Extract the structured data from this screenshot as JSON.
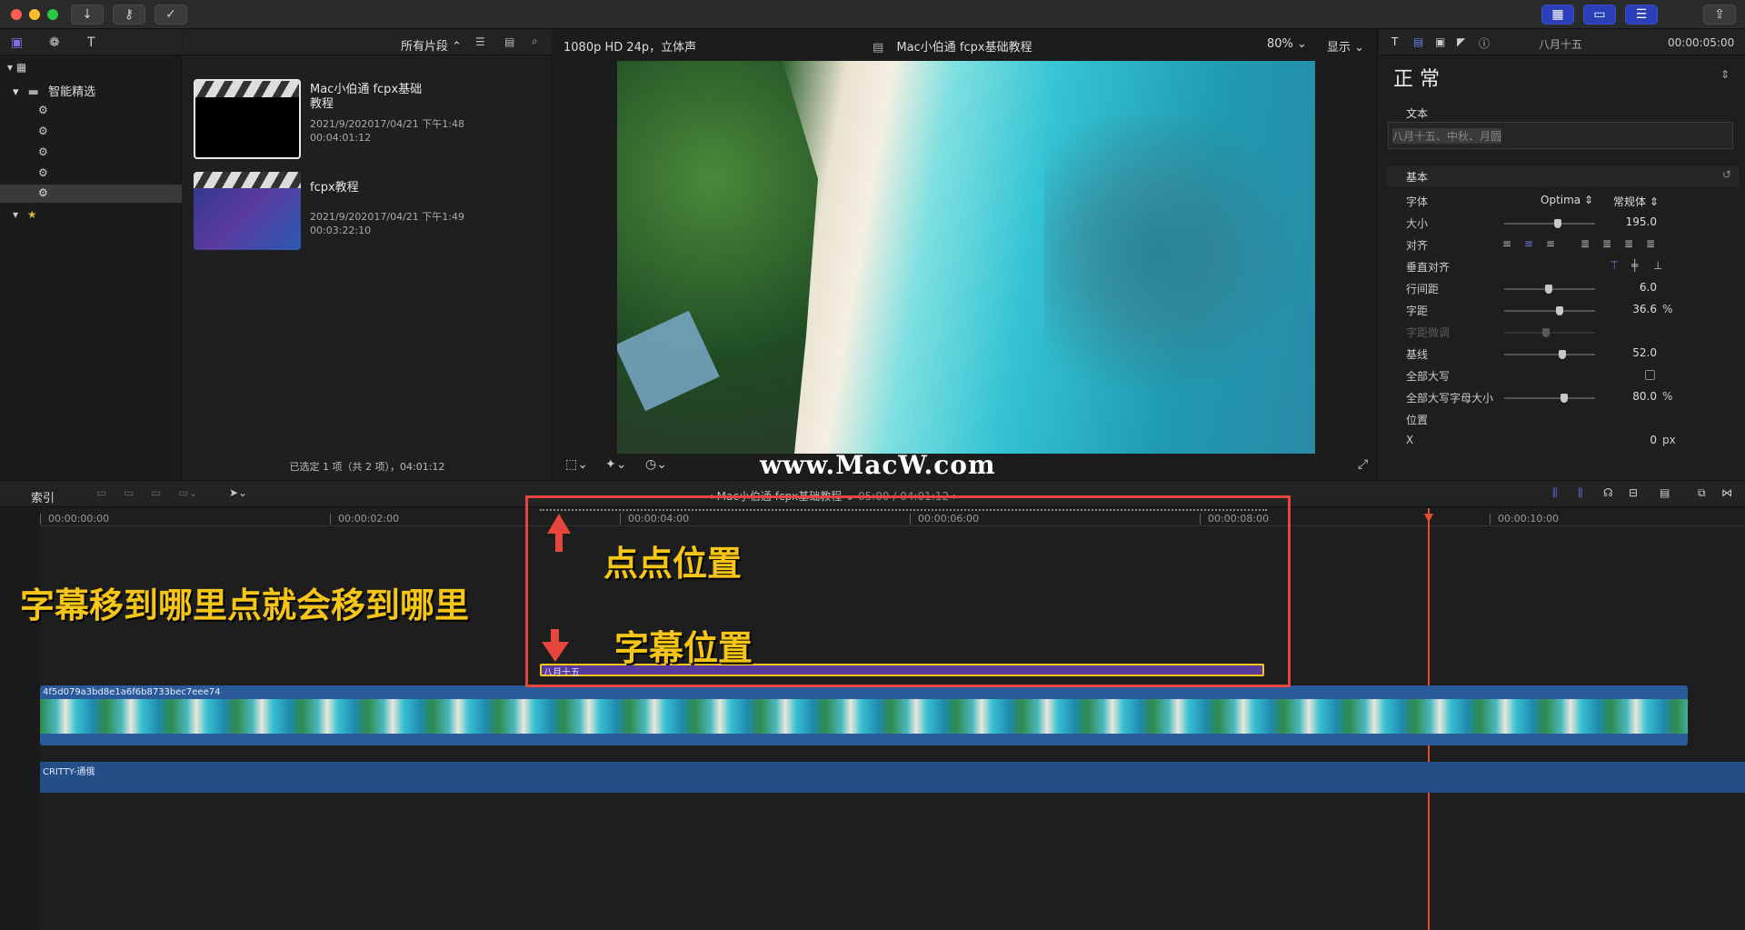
{
  "toolbar": {
    "icons": [
      "import-icon",
      "key-icon",
      "check-circle-icon"
    ],
    "right_icons": [
      "browser-layout-icon",
      "timeline-layout-icon",
      "inspector-layout-icon",
      "share-icon"
    ]
  },
  "library": {
    "tab_icons": [
      "library-icon",
      "photos-icon",
      "titles-icon"
    ],
    "items": [
      {
        "label": "智能精选",
        "icon": "folder-icon"
      },
      {
        "label": "",
        "icon": "gear-icon"
      },
      {
        "label": "",
        "icon": "gear-icon"
      },
      {
        "label": "",
        "icon": "gear-icon"
      },
      {
        "label": "",
        "icon": "gear-icon"
      },
      {
        "label": "",
        "icon": "gear-icon"
      }
    ]
  },
  "browser": {
    "filter_label": "所有片段",
    "clips": [
      {
        "title": "Mac小伯通 fcpx基础\n教程",
        "date": "2021/9/202017/04/21 下午1:48",
        "duration": "00:04:01:12"
      },
      {
        "title": "fcpx教程",
        "date": "2021/9/202017/04/21 下午1:49",
        "duration": "00:03:22:10"
      }
    ],
    "status": "已选定 1 项（共 2 项），04:01:12"
  },
  "viewer": {
    "format": "1080p HD 24p，立体声",
    "project_title": "Mac小伯通 fcpx基础教程",
    "zoom": "80%",
    "display_label": "显示",
    "watermark": "www.MacW.com"
  },
  "inspector": {
    "title_name": "八月十五",
    "timecode": "00:00:05:00",
    "style": "正 常",
    "text_section": "文本",
    "text_value": "八月十五、中秋、月圆",
    "basic_section": "基本",
    "rows": [
      {
        "label": "字体",
        "value": "Optima",
        "value2": "常规体"
      },
      {
        "label": "大小",
        "value": "195.0",
        "slider": 0.55
      },
      {
        "label": "对齐",
        "value": ""
      },
      {
        "label": "垂直对齐",
        "value": ""
      },
      {
        "label": "行间距",
        "value": "6.0",
        "slider": 0.45
      },
      {
        "label": "字距",
        "value": "36.6",
        "unit": "%",
        "slider": 0.57
      },
      {
        "label": "字距微调",
        "value": "",
        "slider": 0.42
      },
      {
        "label": "基线",
        "value": "52.0",
        "slider": 0.6
      },
      {
        "label": "全部大写",
        "value": ""
      },
      {
        "label": "全部大写字母大小",
        "value": "80.0",
        "unit": "%",
        "slider": 0.62
      },
      {
        "label": "位置",
        "value": ""
      },
      {
        "label": "X",
        "value": "0",
        "unit": "px"
      }
    ]
  },
  "timeline": {
    "index_label": "索引",
    "project_label": "Mac小伯通 fcpx基础教程",
    "project_time": "05:00 / 04:01:12",
    "timecodes": [
      "00:00:00:00",
      "00:00:02:00",
      "00:00:04:00",
      "00:00:06:00",
      "00:00:08:00",
      "00:00:10:00"
    ],
    "title_clip": "八月十五",
    "video_clip": "4f5d079a3bd8e1a6f6b8733bec7eee74",
    "audio_clip": "CRITTY-通俄"
  },
  "annotations": {
    "main_text": "字幕移到哪里点就会移到哪里",
    "dot_label": "点点位置",
    "caption_label": "字幕位置"
  },
  "colors": {
    "accent_blue": "#2a3fb8",
    "annotation_yellow": "#f5c518",
    "annotation_red": "#e8453c",
    "title_clip_purple": "#5b3a9e",
    "playhead": "#e0502e"
  }
}
